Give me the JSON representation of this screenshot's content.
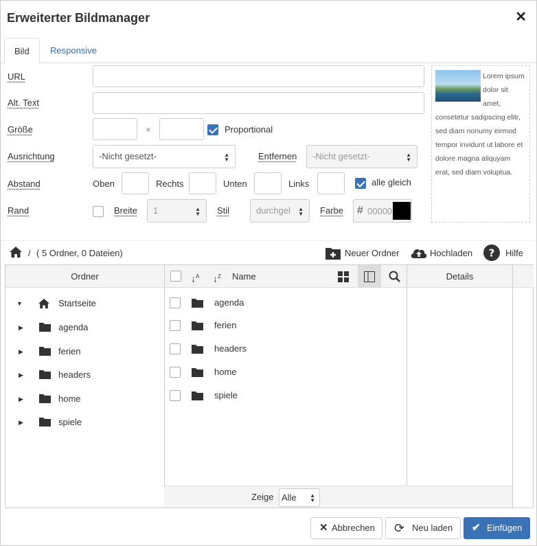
{
  "dialog": {
    "title": "Erweiterter Bildmanager"
  },
  "tabs": [
    {
      "label": "Bild"
    },
    {
      "label": "Responsive"
    }
  ],
  "form": {
    "url_label": "URL",
    "alt_label": "Alt. Text",
    "size_label": "Größe",
    "size_separator": "×",
    "proportional_label": "Proportional",
    "proportional_checked": true,
    "align_label": "Ausrichtung",
    "align_value": "-Nicht gesetzt-",
    "remove_label": "Entfernen",
    "remove_value": "-Nicht gesetzt-",
    "spacing_label": "Abstand",
    "top_label": "Oben",
    "right_label": "Rechts",
    "bottom_label": "Unten",
    "left_label": "Links",
    "all_same_label": "alle gleich",
    "all_same_checked": true,
    "border_label": "Rand",
    "width_label": "Breite",
    "width_value": "1",
    "style_label": "Stil",
    "style_value": "durchgel",
    "color_label": "Farbe",
    "color_hash": "#",
    "color_value": "00000",
    "color_swatch": "#000000"
  },
  "preview": {
    "text": "Lorem ipsum dolor sit amet, consetetur sadipscing elitr, sed diam nonumy eirmod tempor invidunt ut labore et dolore magna aliquyam erat, sed diam voluptua."
  },
  "toolbar": {
    "path_separator": "/",
    "path_info": "( 5 Ordner, 0 Dateien)",
    "new_folder": "Neuer Ordner",
    "upload": "Hochladen",
    "help": "Hilfe"
  },
  "browser": {
    "folders_header": "Ordner",
    "name_header": "Name",
    "details_header": "Details",
    "root": "Startseite",
    "tree": [
      "agenda",
      "ferien",
      "headers",
      "home",
      "spiele"
    ],
    "files": [
      "agenda",
      "ferien",
      "headers",
      "home",
      "spiele"
    ],
    "show_label": "Zeige",
    "show_value": "Alle"
  },
  "buttons": {
    "cancel": "Abbrechen",
    "reload": "Neu laden",
    "insert": "Einfügen"
  },
  "colors": {
    "accent": "#3a72b8",
    "link": "#2f6eb5"
  }
}
